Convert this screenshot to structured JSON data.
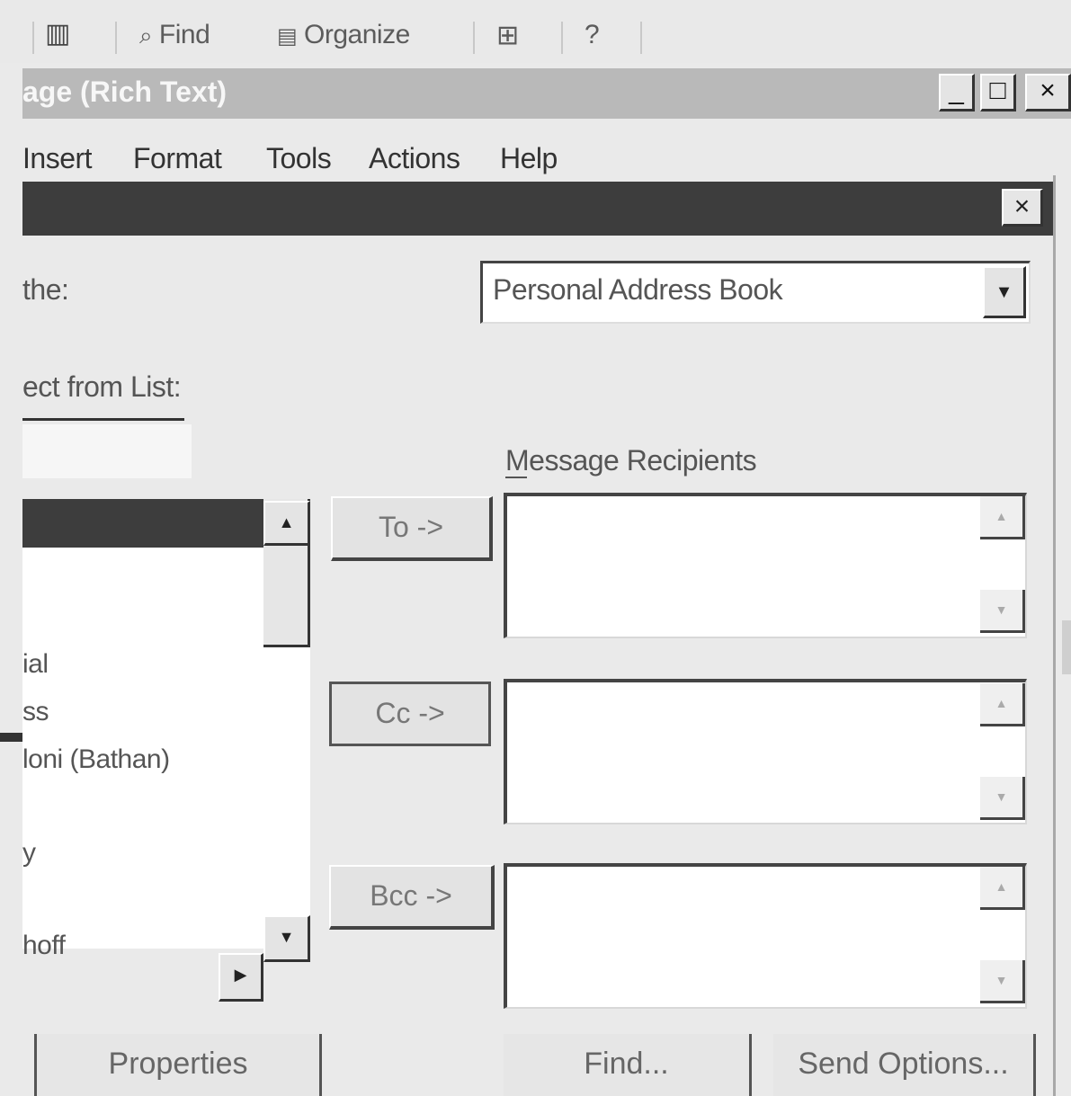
{
  "toolbar": {
    "item1": "",
    "find": "Find",
    "organize": "Organize",
    "help": "?"
  },
  "window": {
    "title": "age (Rich Text)",
    "minimize": "_",
    "maximize": "□",
    "close": "×"
  },
  "menu": {
    "items": [
      "Insert",
      "Format",
      "Tools",
      "Actions",
      "Help"
    ]
  },
  "dialog": {
    "close": "×",
    "show_names_label": "the:",
    "address_book": "Personal Address Book",
    "type_name_label": "ect from List:",
    "recipients_label": "Message Recipients",
    "list_items": [
      "ial",
      "ss",
      "loni (Bathan)",
      "y",
      "hoff"
    ],
    "to_button": "To ->",
    "cc_button": "Cc ->",
    "bcc_button": "Bcc ->",
    "properties_button": "Properties",
    "find_button": "Find...",
    "send_options_button": "Send Options..."
  },
  "icons": {
    "dropdown": "▼",
    "scroll_up": "▲",
    "scroll_down": "▼",
    "scroll_right": "▶"
  }
}
